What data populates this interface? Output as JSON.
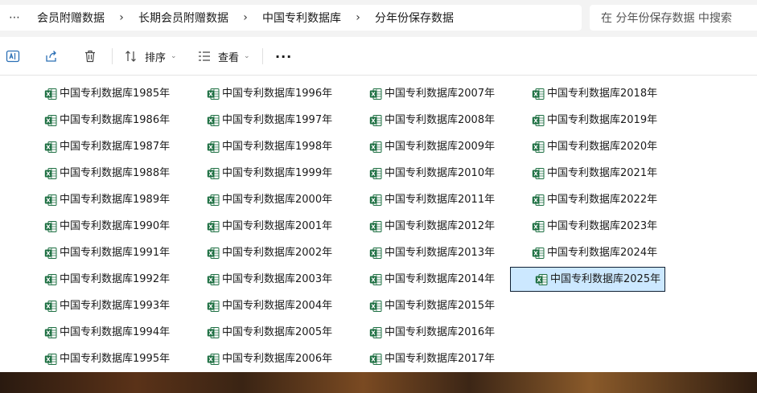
{
  "breadcrumb": {
    "more": "⋯",
    "items": [
      "会员附赠数据",
      "长期会员附赠数据",
      "中国专利数据库",
      "分年份保存数据"
    ],
    "separator": "›"
  },
  "search": {
    "placeholder": "在 分年份保存数据 中搜索"
  },
  "toolbar": {
    "sort_label": "排序",
    "view_label": "查看",
    "more": "···"
  },
  "files": {
    "col1": [
      "中国专利数据库1985年",
      "中国专利数据库1986年",
      "中国专利数据库1987年",
      "中国专利数据库1988年",
      "中国专利数据库1989年",
      "中国专利数据库1990年",
      "中国专利数据库1991年",
      "中国专利数据库1992年",
      "中国专利数据库1993年",
      "中国专利数据库1994年",
      "中国专利数据库1995年"
    ],
    "col2": [
      "中国专利数据库1996年",
      "中国专利数据库1997年",
      "中国专利数据库1998年",
      "中国专利数据库1999年",
      "中国专利数据库2000年",
      "中国专利数据库2001年",
      "中国专利数据库2002年",
      "中国专利数据库2003年",
      "中国专利数据库2004年",
      "中国专利数据库2005年",
      "中国专利数据库2006年"
    ],
    "col3": [
      "中国专利数据库2007年",
      "中国专利数据库2008年",
      "中国专利数据库2009年",
      "中国专利数据库2010年",
      "中国专利数据库2011年",
      "中国专利数据库2012年",
      "中国专利数据库2013年",
      "中国专利数据库2014年",
      "中国专利数据库2015年",
      "中国专利数据库2016年",
      "中国专利数据库2017年"
    ],
    "col4": [
      "中国专利数据库2018年",
      "中国专利数据库2019年",
      "中国专利数据库2020年",
      "中国专利数据库2021年",
      "中国专利数据库2022年",
      "中国专利数据库2023年",
      "中国专利数据库2024年",
      "中国专利数据库2025年"
    ],
    "selected": "中国专利数据库2025年"
  },
  "colors": {
    "excel_green": "#1d6f42",
    "selection_bg": "#cce8ff",
    "selection_border": "#0f1f33"
  },
  "icons": {
    "file_type": "excel-file-icon",
    "toolbar": [
      "rename-icon",
      "share-icon",
      "delete-icon",
      "sort-icon",
      "view-icon",
      "more-icon"
    ]
  }
}
